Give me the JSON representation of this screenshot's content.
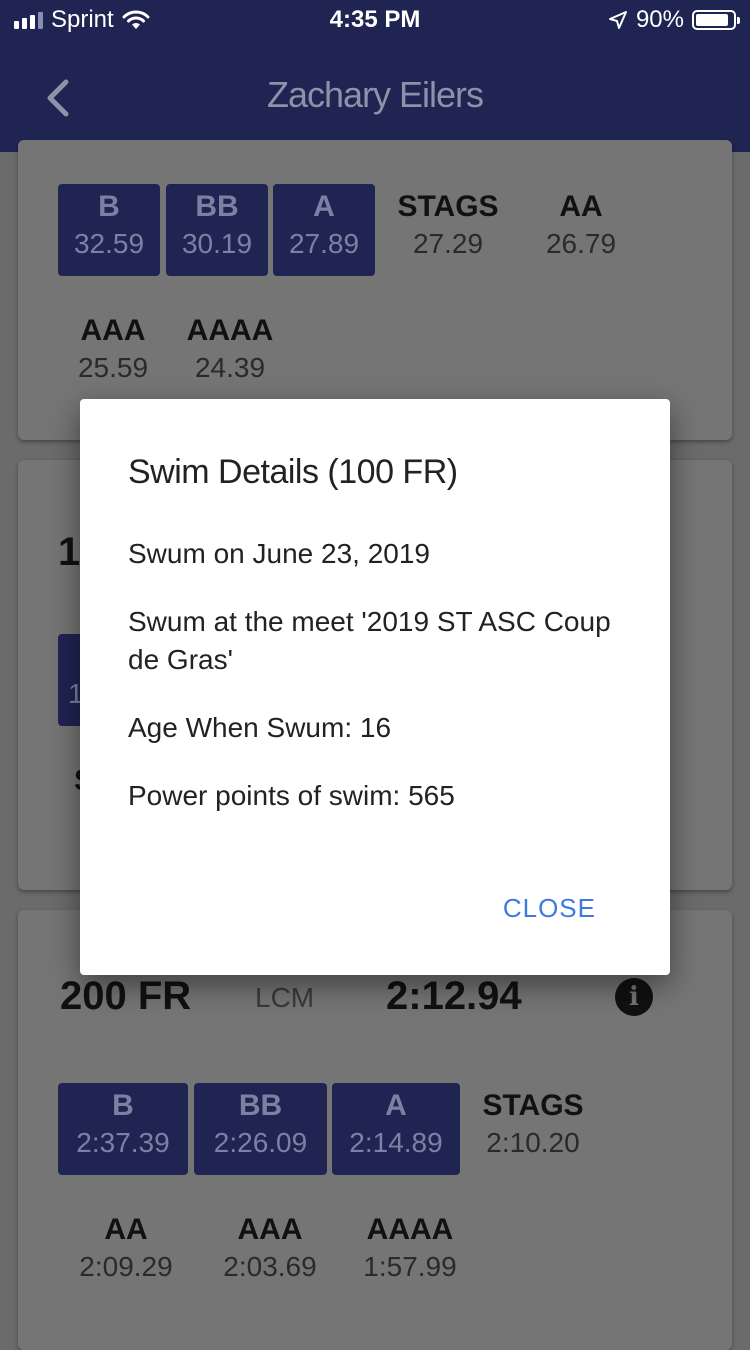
{
  "status_bar": {
    "carrier": "Sprint",
    "time": "4:35 PM",
    "battery": "90%",
    "battery_level": 0.9
  },
  "header": {
    "title": "Zachary Eilers",
    "back_icon": "chevron-left-icon"
  },
  "card1": {
    "badges": [
      {
        "level": "B",
        "time": "32.59"
      },
      {
        "level": "BB",
        "time": "30.19"
      },
      {
        "level": "A",
        "time": "27.89"
      }
    ],
    "standards": [
      {
        "level": "STAGS",
        "time": "27.29"
      },
      {
        "level": "AA",
        "time": "26.79"
      },
      {
        "level": "AAA",
        "time": "25.59"
      },
      {
        "level": "AAAA",
        "time": "24.39"
      }
    ]
  },
  "card2": {
    "partial_event": "1",
    "partial_badge": "1",
    "partial_label": "S"
  },
  "card3": {
    "event": "200 FR",
    "course": "LCM",
    "best_time": "2:12.94",
    "info_icon": "info-icon",
    "badges": [
      {
        "level": "B",
        "time": "2:37.39"
      },
      {
        "level": "BB",
        "time": "2:26.09"
      },
      {
        "level": "A",
        "time": "2:14.89"
      }
    ],
    "standards": [
      {
        "level": "STAGS",
        "time": "2:10.20"
      },
      {
        "level": "AA",
        "time": "2:09.29"
      },
      {
        "level": "AAA",
        "time": "2:03.69"
      },
      {
        "level": "AAAA",
        "time": "1:57.99"
      }
    ]
  },
  "dialog": {
    "title": "Swim Details (100 FR)",
    "swum_on": "Swum on June 23, 2019",
    "meet": "Swum at the meet '2019 ST ASC Coup de Gras'",
    "age": "Age When Swum: 16",
    "power_points": "Power points of swim: 565",
    "close_label": "CLOSE"
  },
  "colors": {
    "header_bg": "#1f2452",
    "badge_bg": "#1f2452",
    "accent_link": "#3d7be0"
  }
}
